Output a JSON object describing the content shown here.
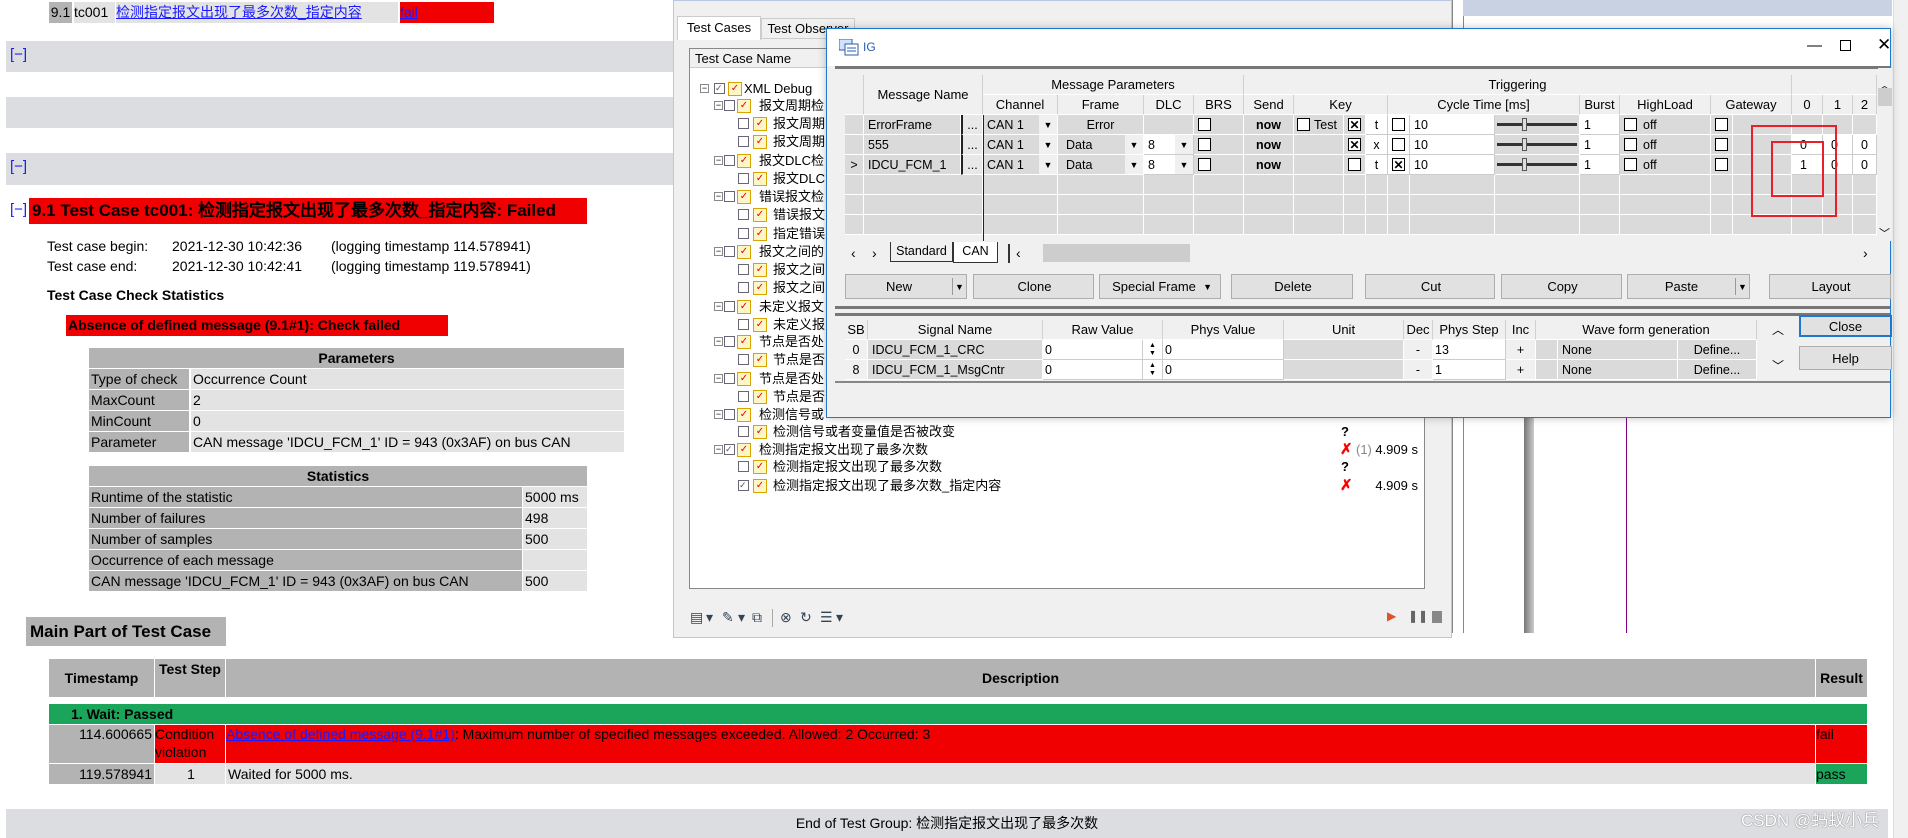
{
  "report": {
    "toc_row": {
      "num": "9.1",
      "id": "tc001",
      "link": "检测指定报文出现了最多次数_指定内容",
      "result": "fail"
    },
    "collapse_label": "[−]",
    "heading": "9.1 Test Case tc001: 检测指定报文出现了最多次数_指定内容: Failed",
    "begin_label": "Test case begin:",
    "begin_value": "2021-12-30 10:42:36",
    "begin_log": "(logging timestamp 114.578941)",
    "end_label": "Test case end:",
    "end_value": "2021-12-30 10:42:41",
    "end_log": "(logging timestamp 119.578941)",
    "check_stats_title": "Test Case Check Statistics",
    "check_failed": "Absence of defined message (9.1#1): Check failed",
    "parameters": {
      "title": "Parameters",
      "rows": [
        [
          "Type of check",
          "Occurrence Count"
        ],
        [
          "MaxCount",
          "2"
        ],
        [
          "MinCount",
          "0"
        ],
        [
          "Parameter",
          "CAN message 'IDCU_FCM_1' ID = 943 (0x3AF) on bus CAN"
        ]
      ]
    },
    "statistics": {
      "title": "Statistics",
      "rows": [
        [
          "Runtime of the statistic",
          "5000 ms"
        ],
        [
          "Number of failures",
          "498"
        ],
        [
          "Number of samples",
          "500"
        ],
        [
          "Occurrence of each message",
          ""
        ],
        [
          "CAN message 'IDCU_FCM_1' ID = 943 (0x3AF) on bus CAN",
          "500"
        ]
      ]
    },
    "main_part_title": "Main Part of Test Case",
    "main_table": {
      "headers": {
        "timestamp": "Timestamp",
        "step": "Test Step",
        "description": "Description",
        "result": "Result"
      },
      "group": "1. Wait: Passed",
      "rows": [
        {
          "timestamp": "114.600665",
          "step": "Condition violation",
          "link": "Absence of defined message (9.1#1)",
          "desc": ": Maximum number of specified messages exceeded. Allowed: 2 Occurred: 3",
          "result": "fail"
        },
        {
          "timestamp": "119.578941",
          "step": "1",
          "link": "",
          "desc": "Waited for 5000 ms.",
          "result": "pass"
        }
      ]
    },
    "end_group": "End of Test Group: 检测指定报文出现了最多次数"
  },
  "test_window": {
    "tabs": [
      "Test Cases",
      "Test Observer"
    ],
    "column_header": "Test Case Name",
    "tree": [
      {
        "level": 0,
        "label": "XML Debug",
        "checked": true,
        "expander": true
      },
      {
        "level": 1,
        "label": "报文周期检",
        "expander": true
      },
      {
        "level": 2,
        "label": "报文周期"
      },
      {
        "level": 2,
        "label": "报文周期"
      },
      {
        "level": 1,
        "label": "报文DLC检",
        "expander": true
      },
      {
        "level": 2,
        "label": "报文DLC"
      },
      {
        "level": 1,
        "label": "错误报文检",
        "expander": true
      },
      {
        "level": 2,
        "label": "错误报文"
      },
      {
        "level": 2,
        "label": "指定错误"
      },
      {
        "level": 1,
        "label": "报文之间的",
        "expander": true
      },
      {
        "level": 2,
        "label": "报文之间"
      },
      {
        "level": 2,
        "label": "报文之间"
      },
      {
        "level": 1,
        "label": "未定义报文",
        "expander": true
      },
      {
        "level": 2,
        "label": "未定义报"
      },
      {
        "level": 1,
        "label": "节点是否处",
        "expander": true
      },
      {
        "level": 2,
        "label": "节点是否"
      },
      {
        "level": 1,
        "label": "节点是否处",
        "expander": true
      },
      {
        "level": 2,
        "label": "节点是否"
      },
      {
        "level": 1,
        "label": "检测信号或",
        "expander": true
      },
      {
        "level": 2,
        "label": "检测信号或者变量值是否被改变",
        "status": "unknown"
      },
      {
        "level": 1,
        "label": "检测指定报文出现了最多次数",
        "checked": true,
        "expander": true,
        "status": "fail",
        "count": "(1)",
        "time": "4.909 s"
      },
      {
        "level": 2,
        "label": "检测指定报文出现了最多次数",
        "status": "unknown"
      },
      {
        "level": 2,
        "label": "检测指定报文出现了最多次数_指定内容",
        "checked": true,
        "status": "fail",
        "time": "4.909 s"
      }
    ]
  },
  "ig": {
    "title": "IG",
    "groups": {
      "params": "Message Parameters",
      "triggering": "Triggering"
    },
    "headers": {
      "name": "Message Name",
      "channel": "Channel",
      "frame": "Frame",
      "dlc": "DLC",
      "brs": "BRS",
      "send": "Send",
      "key": "Key",
      "cycle": "Cycle Time [ms]",
      "burst": "Burst",
      "highload": "HighLoad",
      "gateway": "Gateway",
      "b0": "0",
      "b1": "1",
      "b2": "2"
    },
    "messages": [
      {
        "marker": "",
        "name": "ErrorFrame",
        "channel": "CAN 1",
        "frame": "Error",
        "frame_dd": false,
        "dlc": "",
        "brs": false,
        "send": "now",
        "key_enable": false,
        "key_label": "Test",
        "key_active": true,
        "key_char": "t",
        "cycle_on": false,
        "cycle": "10",
        "burst": "1",
        "highload_on": false,
        "highload": "off",
        "gateway": false,
        "bytes": [
          "",
          "",
          ""
        ]
      },
      {
        "marker": "",
        "name": "555",
        "channel": "CAN 1",
        "frame": "Data",
        "frame_dd": true,
        "dlc": "8",
        "brs": false,
        "send": "now",
        "key_enable": null,
        "key_label": "",
        "key_active": true,
        "key_char": "x",
        "cycle_on": false,
        "cycle": "10",
        "burst": "1",
        "highload_on": false,
        "highload": "off",
        "gateway": false,
        "bytes": [
          "0",
          "0",
          "0"
        ]
      },
      {
        "marker": ">",
        "name": "IDCU_FCM_1",
        "channel": "CAN 1",
        "frame": "Data",
        "frame_dd": true,
        "dlc": "8",
        "brs": false,
        "send": "now",
        "key_enable": null,
        "key_label": "",
        "key_active": false,
        "key_char": "t",
        "cycle_on": true,
        "cycle": "10",
        "burst": "1",
        "highload_on": false,
        "highload": "off",
        "gateway": false,
        "bytes": [
          "1",
          "0",
          "0"
        ]
      }
    ],
    "ellipsis": "...",
    "tabs": [
      "Standard",
      "CAN"
    ],
    "active_tab": "CAN",
    "buttons": {
      "new": "New",
      "clone": "Clone",
      "special_frame": "Special Frame",
      "delete": "Delete",
      "cut": "Cut",
      "copy": "Copy",
      "paste": "Paste",
      "layout": "Layout",
      "close": "Close",
      "help": "Help"
    },
    "signal_headers": {
      "sb": "SB",
      "name": "Signal Name",
      "raw": "Raw Value",
      "phys": "Phys Value",
      "unit": "Unit",
      "dec": "Dec",
      "step": "Phys Step",
      "inc": "Inc",
      "wave": "Wave form generation"
    },
    "signals": [
      {
        "sb": "0",
        "name": "IDCU_FCM_1_CRC",
        "raw": "0",
        "phys": "0",
        "unit": "",
        "dec": "-",
        "step": "13",
        "inc": "+",
        "wave": "None",
        "define": "Define..."
      },
      {
        "sb": "8",
        "name": "IDCU_FCM_1_MsgCntr",
        "raw": "0",
        "phys": "0",
        "unit": "",
        "dec": "-",
        "step": "1",
        "inc": "+",
        "wave": "None",
        "define": "Define..."
      }
    ]
  },
  "colors": {
    "fail": "#f00000",
    "pass": "#1ba55a",
    "header_gray": "#b3b3b3",
    "cell_gray": "#e3e3e3",
    "annotation": "#e8202a"
  },
  "watermark": "CSDN @蚂蚁小兵"
}
